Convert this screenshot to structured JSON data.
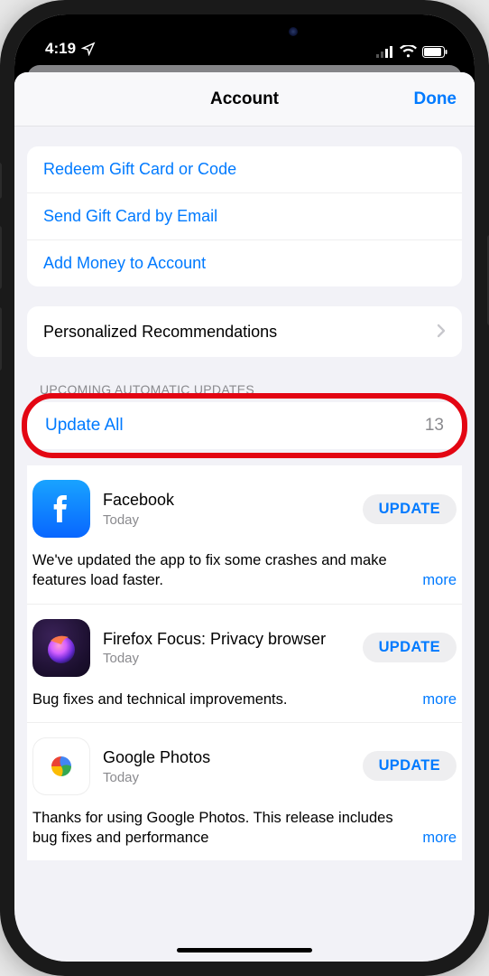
{
  "status": {
    "time": "4:19",
    "has_location_arrow": true
  },
  "nav": {
    "title": "Account",
    "done": "Done"
  },
  "actions": {
    "redeem": "Redeem Gift Card or Code",
    "send_gift": "Send Gift Card by Email",
    "add_money": "Add Money to Account"
  },
  "recommendations": {
    "label": "Personalized Recommendations"
  },
  "updates": {
    "section_header": "UPCOMING AUTOMATIC UPDATES",
    "update_all_label": "Update All",
    "update_all_count": "13",
    "update_button": "UPDATE",
    "more_label": "more",
    "apps": [
      {
        "icon": "facebook",
        "name": "Facebook",
        "date": "Today",
        "desc": "We've updated the app to fix some crashes and make features load faster."
      },
      {
        "icon": "firefox-focus",
        "name": "Firefox Focus: Privacy browser",
        "date": "Today",
        "desc": "Bug fixes and technical improvements."
      },
      {
        "icon": "google-photos",
        "name": "Google Photos",
        "date": "Today",
        "desc": "Thanks for using Google Photos. This release includes bug fixes and performance"
      }
    ]
  }
}
